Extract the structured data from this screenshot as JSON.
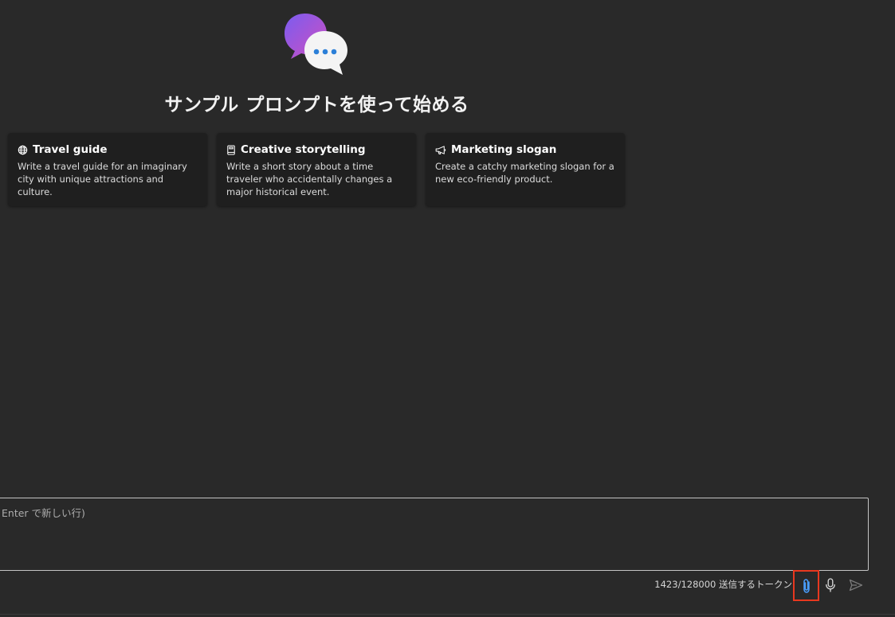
{
  "header": {
    "logo_icon": "chat-bubbles-icon",
    "heading": "サンプル プロンプトを使って始める"
  },
  "sample_prompts": [
    {
      "icon": "globe-icon",
      "title": "Travel guide",
      "description": "Write a travel guide for an imaginary city with unique attractions and culture."
    },
    {
      "icon": "book-icon",
      "title": "Creative storytelling",
      "description": "Write a short story about a time traveler who accidentally changes a major historical event."
    },
    {
      "icon": "megaphone-icon",
      "title": "Marketing slogan",
      "description": "Create a catchy marketing slogan for a new eco-friendly product."
    }
  ],
  "composer": {
    "placeholder": "Enter で新しい行)",
    "value": ""
  },
  "footer": {
    "token_count": "1423/128000 送信するトークン",
    "attach_icon": "paperclip-icon",
    "mic_icon": "microphone-icon",
    "send_icon": "send-icon"
  },
  "colors": {
    "background": "#292929",
    "card": "#1f1f1f",
    "accent": "#4a9eff",
    "highlight_box": "#e8381f",
    "logo_purple": "#8b4fe0",
    "logo_pink": "#c84fc8",
    "logo_dots": "#2b7fd8"
  }
}
